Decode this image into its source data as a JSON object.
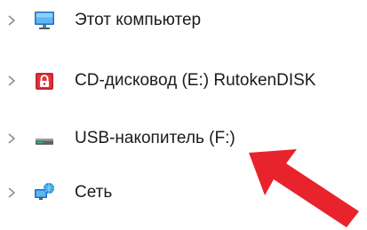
{
  "nav_tree": {
    "items": [
      {
        "label": "Этот компьютер",
        "icon": "monitor-icon"
      },
      {
        "label": "CD-дисковод (E:) RutokenDISK",
        "icon": "cd-drive-lock-icon"
      },
      {
        "label": "USB-накопитель (F:)",
        "icon": "usb-drive-icon"
      },
      {
        "label": "Сеть",
        "icon": "network-icon"
      }
    ]
  },
  "annotation": {
    "arrow_color": "#e8232b",
    "icon": "red-arrow-pointer"
  }
}
